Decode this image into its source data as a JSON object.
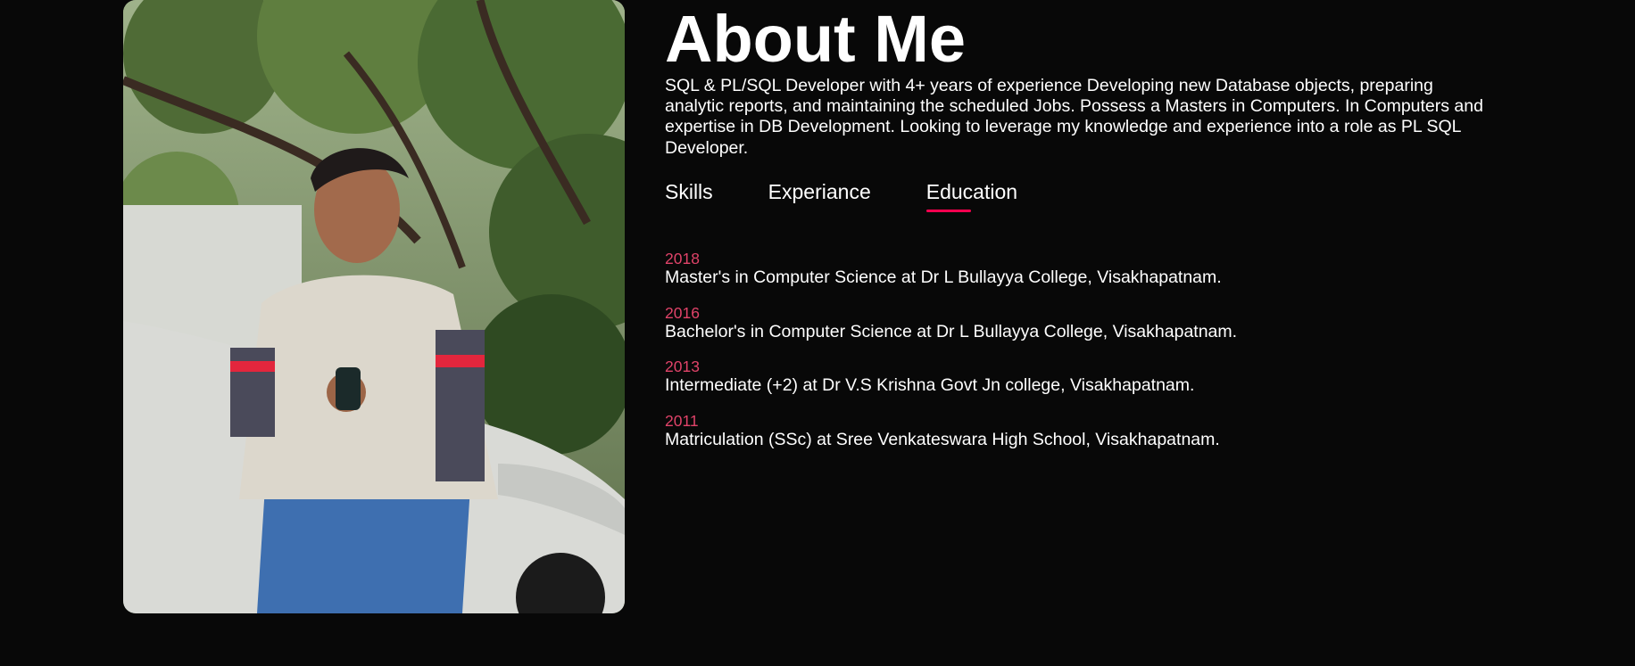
{
  "about": {
    "title": "About Me",
    "intro": "SQL & PL/SQL Developer with 4+ years of experience Developing new Database objects, preparing analytic reports, and maintaining the scheduled Jobs. Possess a Masters in Computers. In Computers and expertise in DB Development. Looking to leverage my knowledge and experience into a role as PL SQL Developer."
  },
  "tabs": [
    {
      "label": "Skills",
      "active": false
    },
    {
      "label": "Experiance",
      "active": false
    },
    {
      "label": "Education",
      "active": true
    }
  ],
  "education": [
    {
      "year": "2018",
      "desc": "Master's in Computer Science at Dr L Bullayya College, Visakhapatnam."
    },
    {
      "year": "2016",
      "desc": "Bachelor's in Computer Science at Dr L Bullayya College, Visakhapatnam."
    },
    {
      "year": "2013",
      "desc": "Intermediate (+2) at Dr V.S Krishna Govt Jn college, Visakhapatnam."
    },
    {
      "year": "2011",
      "desc": "Matriculation (SSc) at Sree Venkateswara High School, Visakhapatnam."
    }
  ],
  "colors": {
    "background": "#080808",
    "accent": "#ff004f",
    "year": "#e04369"
  }
}
